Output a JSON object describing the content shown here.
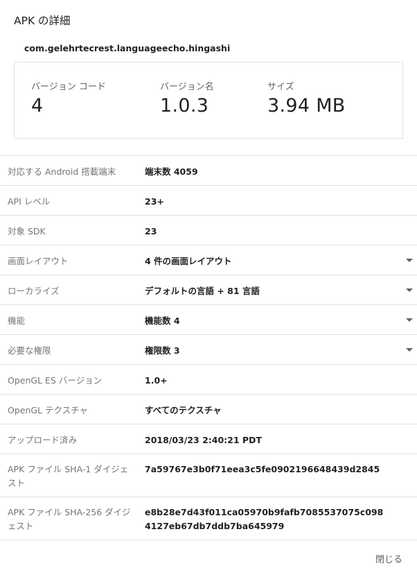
{
  "dialog": {
    "title": "APK の詳細",
    "package_name": "com.gelehrtecrest.languageecho.hingashi",
    "close_label": "閉じる"
  },
  "summary": {
    "version_code": {
      "label": "バージョン コード",
      "value": "4"
    },
    "version_name": {
      "label": "バージョン名",
      "value": "1.0.3"
    },
    "size": {
      "label": "サイズ",
      "value": "3.94 MB"
    }
  },
  "details": [
    {
      "label": "対応する Android 搭載端末",
      "value": "端末数 4059"
    },
    {
      "label": "API レベル",
      "value": "23+"
    },
    {
      "label": "対象 SDK",
      "value": "23"
    },
    {
      "label": "画面レイアウト",
      "value": "4 件の画面レイアウト"
    },
    {
      "label": "ローカライズ",
      "value": "デフォルトの言語 + 81 言語"
    },
    {
      "label": "機能",
      "value": "機能数 4"
    },
    {
      "label": "必要な権限",
      "value": "権限数 3"
    },
    {
      "label": "OpenGL ES バージョン",
      "value": "1.0+"
    },
    {
      "label": "OpenGL テクスチャ",
      "value": "すべてのテクスチャ"
    },
    {
      "label": "アップロード済み",
      "value": "2018/03/23 2:40:21 PDT"
    },
    {
      "label": "APK ファイル SHA-1 ダイジェスト",
      "value": "7a59767e3b0f71eea3c5fe0902196648439d2845"
    },
    {
      "label": "APK ファイル SHA-256 ダイジェスト",
      "value": "e8b28e7d43f011ca05970b9fafb7085537075c0984127eb67db7ddb7ba645979"
    }
  ]
}
